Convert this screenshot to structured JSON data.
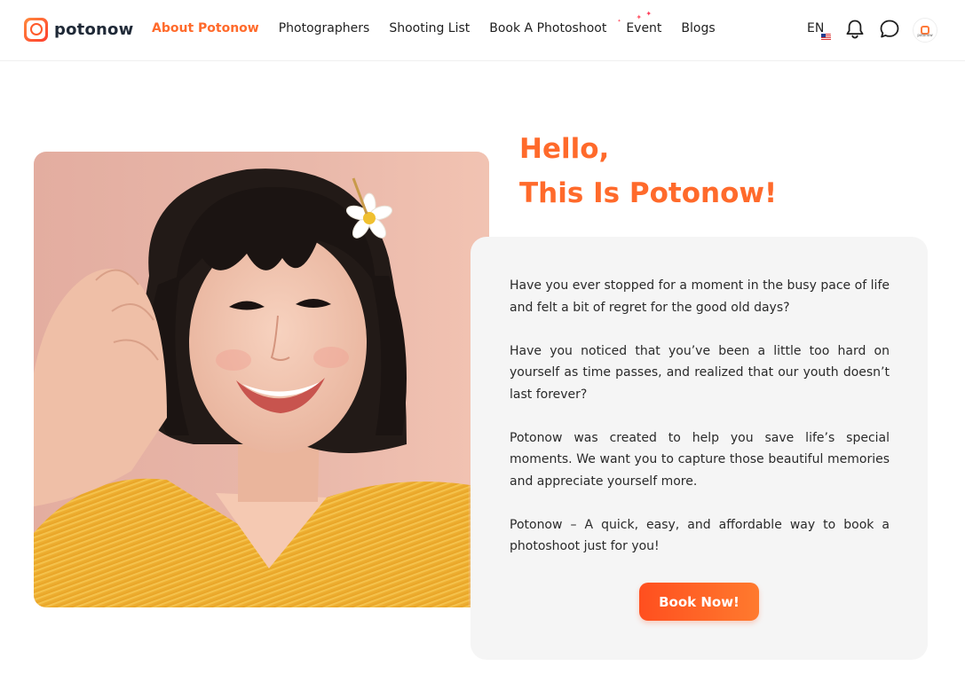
{
  "brand": {
    "name": "potonow",
    "accent": "#ff6a2b"
  },
  "nav": {
    "items": [
      {
        "label": "About Potonow",
        "active": true
      },
      {
        "label": "Photographers",
        "active": false
      },
      {
        "label": "Shooting List",
        "active": false
      },
      {
        "label": "Book A Photoshoot",
        "active": false
      },
      {
        "label": "Event",
        "active": false
      },
      {
        "label": "Blogs",
        "active": false
      }
    ]
  },
  "header_right": {
    "language": "EN",
    "icons": [
      "us-flag-icon",
      "bell-icon",
      "chat-bubble-icon",
      "profile-avatar-icon"
    ],
    "avatar_text": "potonow"
  },
  "hero": {
    "heading_line1": "Hello,",
    "heading_line2": "This Is Potonow!",
    "paragraphs": [
      "Have you ever stopped for a moment in the busy pace of life and felt a bit of regret for the good old days?",
      "Have you noticed that you’ve been a little too hard on yourself as time passes, and realized that our youth doesn’t last forever?",
      "Potonow was created to help you save life’s special moments. We want you to capture those beautiful memories and appreciate yourself more.",
      "Potonow – A quick, easy, and affordable way to book a photoshoot just for you!"
    ],
    "cta": "Book Now!"
  }
}
